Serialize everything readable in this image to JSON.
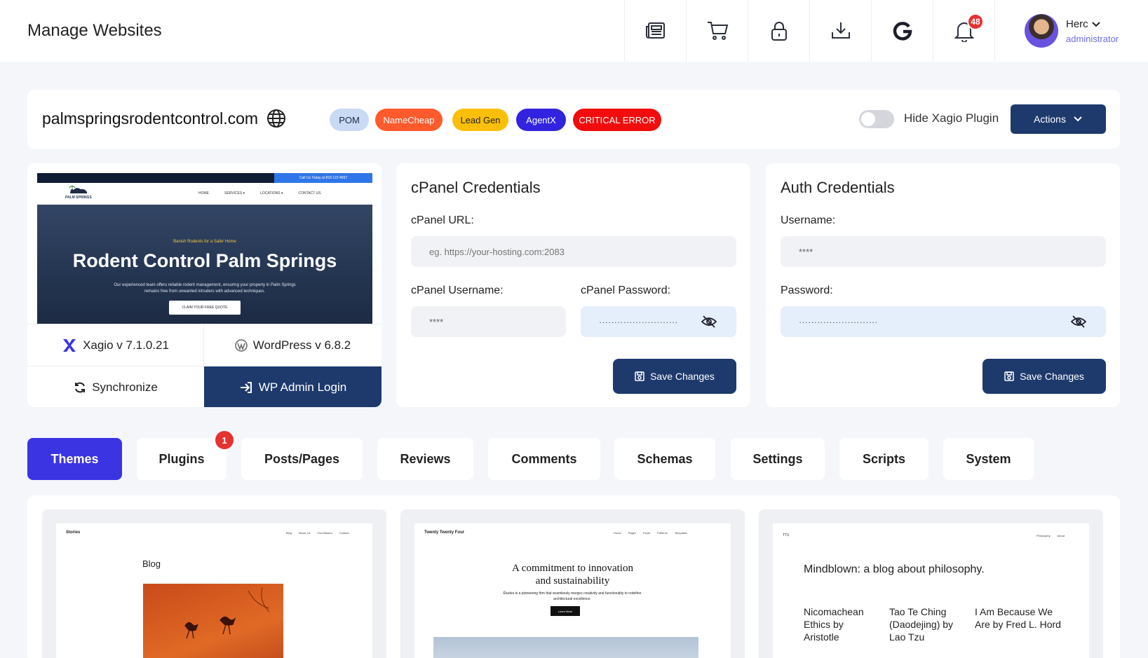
{
  "header": {
    "title": "Manage Websites",
    "icons": [
      "news-icon",
      "cart-icon",
      "lock-icon",
      "download-icon",
      "google-icon",
      "bell-icon"
    ],
    "notification_count": "48",
    "user": {
      "name": "Herc",
      "role": "administrator"
    }
  },
  "site": {
    "domain": "palmspringsrodentcontrol.com",
    "tags": [
      {
        "label": "POM",
        "bg": "#c9daf5",
        "fg": "#1d2b44"
      },
      {
        "label": "NameCheap",
        "bg": "#ff5a2c",
        "fg": "#ffffff"
      },
      {
        "label": "Lead Gen",
        "bg": "#fbbf0a",
        "fg": "#222222"
      },
      {
        "label": "AgentX",
        "bg": "#3224de",
        "fg": "#ffffff"
      },
      {
        "label": "CRITICAL ERROR",
        "bg": "#f20c0c",
        "fg": "#ffffff"
      }
    ],
    "hide_plugin_label": "Hide Xagio Plugin",
    "hide_plugin_on": false,
    "actions_label": "Actions"
  },
  "preview": {
    "top_strip": "Call Us Today at 818 123 4567",
    "logo": "PALM SPRINGS",
    "nav_links": [
      "HOME",
      "SERVICES ▾",
      "LOCATIONS ▾",
      "CONTACT US"
    ],
    "kicker": "Banish Rodents for a Safer Home",
    "headline": "Rodent Control Palm Springs",
    "sub": "Our experienced team offers reliable rodent management, ensuring your property in Palm Springs remains free from unwanted intruders with advanced techniques.",
    "cta": "CLAIM YOUR FREE QUOTE",
    "xagio_version": "Xagio v 7.1.0.21",
    "wp_version": "WordPress v 6.8.2",
    "sync_label": "Synchronize",
    "wp_login_label": "WP Admin Login"
  },
  "cpanel": {
    "title": "cPanel Credentials",
    "url_label": "cPanel URL:",
    "url_placeholder": "eg. https://your-hosting.com:2083",
    "username_label": "cPanel Username:",
    "username_value": "****",
    "password_label": "cPanel Password:",
    "password_value": "··························",
    "save_label": "Save Changes"
  },
  "auth": {
    "title": "Auth Credentials",
    "username_label": "Username:",
    "username_value": "****",
    "password_label": "Password:",
    "password_value": "··························",
    "save_label": "Save Changes"
  },
  "tabs": [
    {
      "label": "Themes",
      "active": true
    },
    {
      "label": "Plugins",
      "badge": "1"
    },
    {
      "label": "Posts/Pages"
    },
    {
      "label": "Reviews"
    },
    {
      "label": "Comments"
    },
    {
      "label": "Schemas"
    },
    {
      "label": "Settings"
    },
    {
      "label": "Scripts"
    },
    {
      "label": "System"
    }
  ],
  "themes": [
    {
      "site_name": "Stories",
      "links": [
        "Blog",
        "About Us",
        "Our Mission",
        "Contact"
      ],
      "heading": "Blog"
    },
    {
      "site_name": "Twenty Twenty Four",
      "links": [
        "Home",
        "Pages",
        "Posts",
        "Patterns",
        "Templates"
      ],
      "heading_line1": "A commitment to innovation",
      "heading_line2": "and sustainability",
      "body": "Études is a pioneering firm that seamlessly merges creativity and functionality to redefine architectural excellence.",
      "button": "Learn More"
    },
    {
      "site_name": "TT3",
      "links": [
        "Philosophy",
        "About"
      ],
      "heading": "Mindblown: a blog about philosophy.",
      "posts": [
        "Nicomachean Ethics by Aristotle",
        "Tao Te Ching (Daodejing) by Lao Tzu",
        "I Am Because We Are by Fred L. Hord"
      ]
    }
  ]
}
